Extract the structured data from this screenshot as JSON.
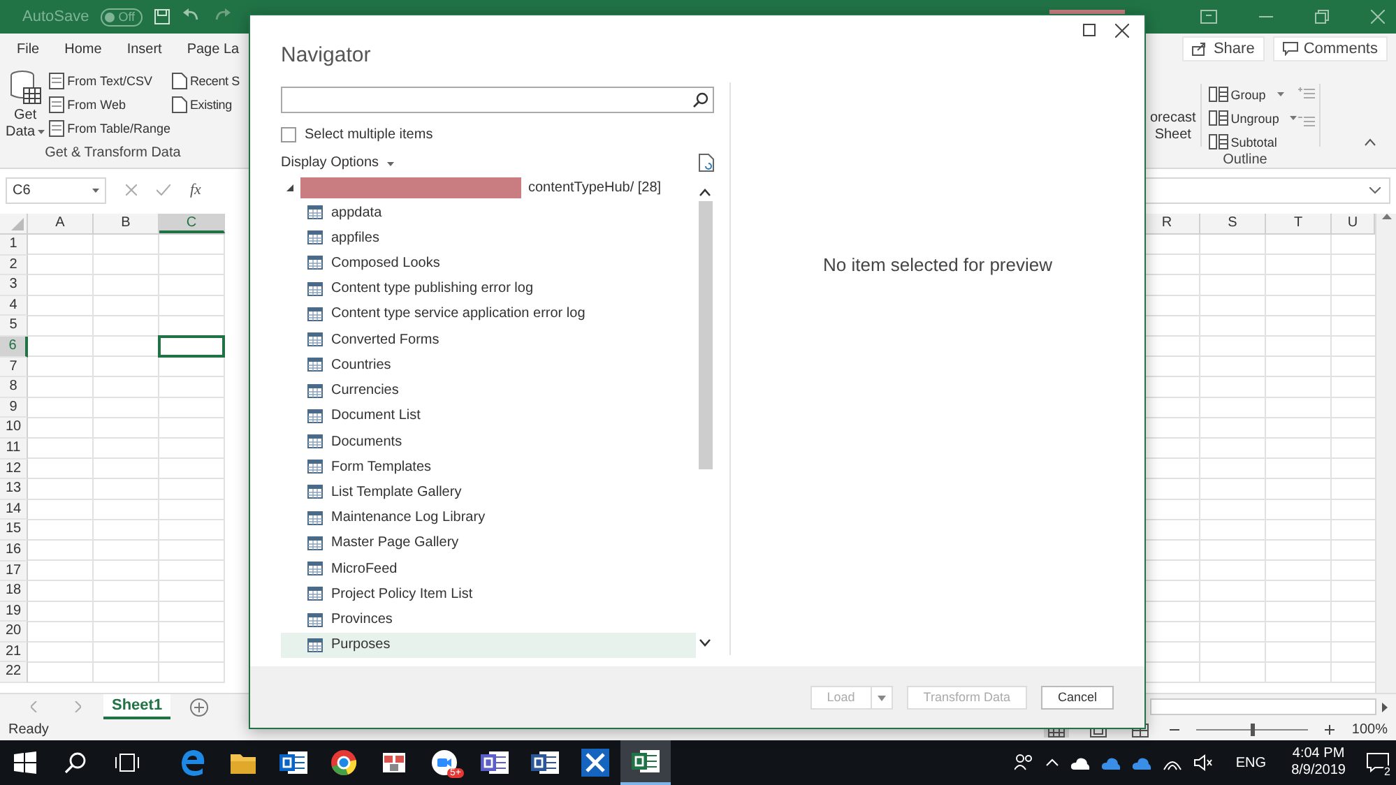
{
  "title_bar": {
    "autosave_label": "AutoSave",
    "autosave_toggle": {
      "label": "Off",
      "on": false
    },
    "user_redacted": true
  },
  "ribbon_tabs": [
    {
      "label": "File"
    },
    {
      "label": "Home"
    },
    {
      "label": "Insert"
    },
    {
      "label": "Page La"
    }
  ],
  "ribbon_left": {
    "get_data": [
      "Get",
      "Data"
    ],
    "commands": [
      "From Text/CSV",
      "From Web",
      "From Table/Range"
    ],
    "more_commands": [
      "Recent S",
      "Existing"
    ],
    "group_label": "Get & Transform Data"
  },
  "ribbon_right": {
    "forecast": [
      "orecast",
      "Sheet"
    ],
    "outline_commands": [
      {
        "label": "Group",
        "dropdown": true
      },
      {
        "label": "Ungroup",
        "dropdown": true
      },
      {
        "label": "Subtotal",
        "dropdown": false
      }
    ],
    "group_label": "Outline",
    "share": "Share",
    "comments": "Comments"
  },
  "formula_bar": {
    "name_box": "C6",
    "function_label": "fx"
  },
  "columns_left": [
    {
      "label": "A",
      "selected": false
    },
    {
      "label": "B",
      "selected": false
    },
    {
      "label": "C",
      "selected": true
    }
  ],
  "columns_right": [
    {
      "label": "R",
      "selected": false
    },
    {
      "label": "S",
      "selected": false
    },
    {
      "label": "T",
      "selected": false
    },
    {
      "label": "U",
      "selected": false
    }
  ],
  "rows": [
    {
      "label": "1",
      "selected": false
    },
    {
      "label": "2",
      "selected": false
    },
    {
      "label": "3",
      "selected": false
    },
    {
      "label": "4",
      "selected": false
    },
    {
      "label": "5",
      "selected": false
    },
    {
      "label": "6",
      "selected": true
    },
    {
      "label": "7",
      "selected": false
    },
    {
      "label": "8",
      "selected": false
    },
    {
      "label": "9",
      "selected": false
    },
    {
      "label": "10",
      "selected": false
    },
    {
      "label": "11",
      "selected": false
    },
    {
      "label": "12",
      "selected": false
    },
    {
      "label": "13",
      "selected": false
    },
    {
      "label": "14",
      "selected": false
    },
    {
      "label": "15",
      "selected": false
    },
    {
      "label": "16",
      "selected": false
    },
    {
      "label": "17",
      "selected": false
    },
    {
      "label": "18",
      "selected": false
    },
    {
      "label": "19",
      "selected": false
    },
    {
      "label": "20",
      "selected": false
    },
    {
      "label": "21",
      "selected": false
    },
    {
      "label": "22",
      "selected": false
    }
  ],
  "sheet_tabs": [
    {
      "label": "Sheet1",
      "selected": true
    }
  ],
  "status_bar": {
    "status": "Ready",
    "zoom": {
      "level": 0.5,
      "reading": "100%"
    }
  },
  "navigator": {
    "title": "Navigator",
    "select_multiple": {
      "label": "Select multiple items",
      "checked": false
    },
    "display_options": "Display Options",
    "tree": {
      "label": "contentTypeHub/ [28]",
      "redacted": true,
      "expanded": true,
      "children": [
        {
          "label": "appdata",
          "selected": false
        },
        {
          "label": "appfiles",
          "selected": false
        },
        {
          "label": "Composed Looks",
          "selected": false
        },
        {
          "label": "Content type publishing error log",
          "selected": false
        },
        {
          "label": "Content type service application error log",
          "selected": false
        },
        {
          "label": "Converted Forms",
          "selected": false
        },
        {
          "label": "Countries",
          "selected": false
        },
        {
          "label": "Currencies",
          "selected": false
        },
        {
          "label": "Document List",
          "selected": false
        },
        {
          "label": "Documents",
          "selected": false
        },
        {
          "label": "Form Templates",
          "selected": false
        },
        {
          "label": "List Template Gallery",
          "selected": false
        },
        {
          "label": "Maintenance Log Library",
          "selected": false
        },
        {
          "label": "Master Page Gallery",
          "selected": false
        },
        {
          "label": "MicroFeed",
          "selected": false
        },
        {
          "label": "Project Policy Item List",
          "selected": false
        },
        {
          "label": "Provinces",
          "selected": false
        },
        {
          "label": "Purposes",
          "selected": true
        }
      ]
    },
    "preview_message": "No item selected for preview",
    "buttons": [
      {
        "label": "Load",
        "kind": "split",
        "disabled": true
      },
      {
        "label": "Transform Data",
        "kind": "plain",
        "disabled": true
      },
      {
        "label": "Cancel",
        "kind": "plain",
        "disabled": false
      }
    ]
  },
  "taskbar": {
    "apps": [
      {
        "kind": "edge",
        "active": false
      },
      {
        "kind": "folder",
        "active": false
      },
      {
        "kind": "outlook",
        "active": false
      },
      {
        "kind": "chrome",
        "active": false
      },
      {
        "kind": "app",
        "active": false
      },
      {
        "kind": "zoom",
        "active": false,
        "badge": "5+"
      },
      {
        "kind": "teams",
        "active": false
      },
      {
        "kind": "word",
        "active": false
      },
      {
        "kind": "tools",
        "active": false
      },
      {
        "kind": "excel",
        "active": true
      }
    ],
    "language": "ENG",
    "time": "4:04 PM",
    "date": "8/9/2019",
    "notifications": "2"
  }
}
